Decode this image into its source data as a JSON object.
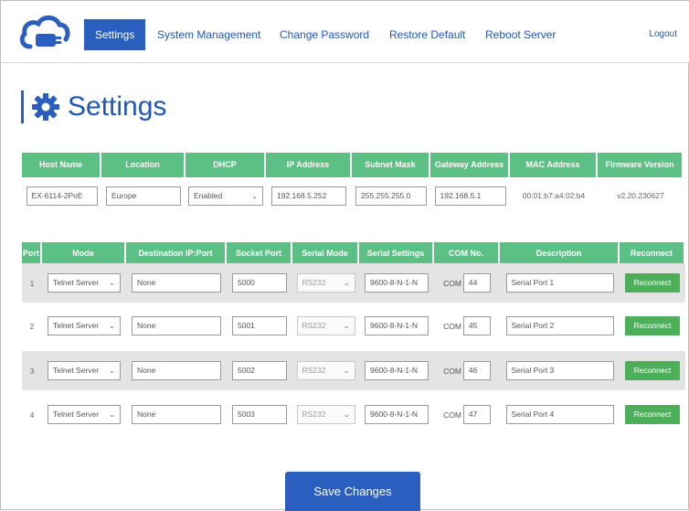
{
  "nav": {
    "items": [
      {
        "label": "Settings",
        "active": true
      },
      {
        "label": "System Management"
      },
      {
        "label": "Change Password"
      },
      {
        "label": "Restore Default"
      },
      {
        "label": "Reboot Server"
      }
    ],
    "logout": "Logout"
  },
  "page": {
    "title": "Settings"
  },
  "host": {
    "headers": [
      "Host Name",
      "Location",
      "DHCP",
      "IP Address",
      "Subnet Mask",
      "Gateway Address",
      "MAC Address",
      "Firmware Version"
    ],
    "host_name": "EX-6114-2PoE",
    "location": "Europe",
    "dhcp": "Enabled",
    "ip_address": "192.168.5.252",
    "subnet_mask": "255.255.255.0",
    "gateway": "192.168.5.1",
    "mac": "00:01:b7:a4:02:b4",
    "firmware": "v2.20.230627"
  },
  "ports": {
    "headers": [
      "Port",
      "Mode",
      "Destination IP:Port",
      "Socket Port",
      "Serial Mode",
      "Serial Settings",
      "COM No.",
      "Description",
      "Reconnect"
    ],
    "com_prefix": "COM",
    "reconnect_label": "Reconnect",
    "rows": [
      {
        "port": "1",
        "mode": "Telnet Server",
        "dest": "None",
        "socket": "5000",
        "serial_mode": "RS232",
        "settings": "9600-8-N-1-N",
        "com": "44",
        "desc": "Serial Port 1"
      },
      {
        "port": "2",
        "mode": "Telnet Server",
        "dest": "None",
        "socket": "5001",
        "serial_mode": "RS232",
        "settings": "9600-8-N-1-N",
        "com": "45",
        "desc": "Serial Port 2"
      },
      {
        "port": "3",
        "mode": "Telnet Server",
        "dest": "None",
        "socket": "5002",
        "serial_mode": "RS232",
        "settings": "9600-8-N-1-N",
        "com": "46",
        "desc": "Serial Port 3"
      },
      {
        "port": "4",
        "mode": "Telnet Server",
        "dest": "None",
        "socket": "5003",
        "serial_mode": "RS232",
        "settings": "9600-8-N-1-N",
        "com": "47",
        "desc": "Serial Port 4"
      }
    ]
  },
  "save_label": "Save Changes",
  "colors": {
    "brand_blue": "#2b5fbf",
    "header_green": "#5cbf84",
    "button_green": "#4cb05a"
  }
}
